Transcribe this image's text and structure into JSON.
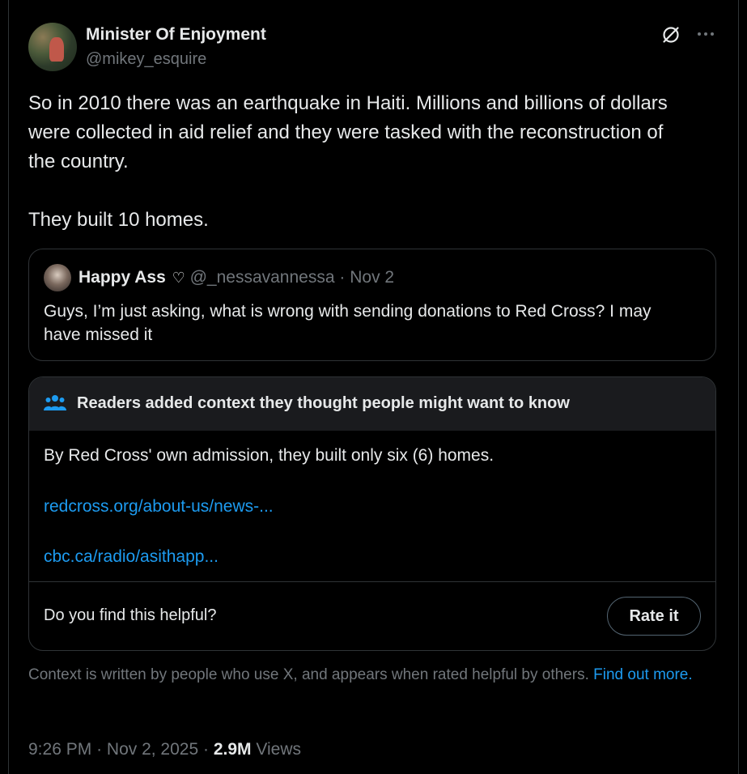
{
  "author": {
    "name": "Minister Of Enjoyment",
    "handle": "@mikey_esquire",
    "avatar": "profile-photo"
  },
  "actions": {
    "grok_icon": "grok-slash-circle-icon",
    "more_icon": "more-horizontal-icon"
  },
  "post": {
    "paragraph_1": "So in 2010 there was an earthquake in Haiti. Millions and billions of dollars were collected in aid relief and they were tasked with the reconstruction of the country.",
    "paragraph_2": "They built 10 homes."
  },
  "quote": {
    "name": "Happy Ass",
    "heart": "♡",
    "handle": "@_nessavannessa",
    "separator": "·",
    "date": "Nov 2",
    "text": "Guys, I’m just asking, what is wrong with sending donations to Red Cross? I may have missed it"
  },
  "community_note": {
    "icon": "people-icon",
    "title": "Readers added context they thought people might want to know",
    "text": "By Red Cross' own admission, they built only six (6) homes.",
    "links": [
      "redcross.org/about-us/news-...",
      "cbc.ca/radio/asithapp..."
    ],
    "helpful_question": "Do you find this helpful?",
    "rate_label": "Rate it"
  },
  "context_footer": {
    "text": "Context is written by people who use X, and appears when rated helpful by others.",
    "link": "Find out more."
  },
  "meta": {
    "time": "9:26 PM",
    "separator": "·",
    "date": "Nov 2, 2025",
    "separator2": "·",
    "views_count": "2.9M",
    "views_label": "Views"
  },
  "colors": {
    "background": "#000000",
    "text": "#e7e9ea",
    "secondary_text": "#71767b",
    "link": "#1d9bf0",
    "border": "#2f3336",
    "note_header": "#1a1b1e"
  }
}
